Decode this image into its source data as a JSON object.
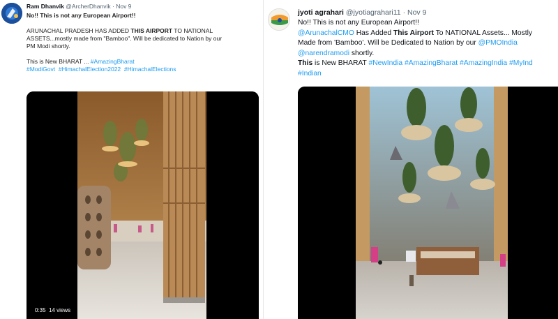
{
  "left_tweet": {
    "display_name": "Ram Dhanvik",
    "handle": "@ArcherDhanvik",
    "separator": "·",
    "date": "Nov 9",
    "line1": "No!! This is not any European Airport!!",
    "line2a": "ARUNACHAL PRADESH HAS ADDED ",
    "line2b": "THIS AIRPORT",
    "line2c": " TO NATIONAL",
    "line3": "ASSETS...mostly made from \"Bamboo\". Will be dedicated to Nation by our",
    "line4": "PM Modi shortly.",
    "line5a": "This is New BHARAT ... ",
    "tag_amazing": "#AmazingBharat",
    "tag_modigovt": "#ModiGovt",
    "tag_himachal2022": "#HimachalElection2022",
    "tag_himachal": "#HimachalElections",
    "video_time": "0:35",
    "video_views": "14 views"
  },
  "right_tweet": {
    "display_name": "jyoti agrahari",
    "handle": "@jyotiagrahari11",
    "separator": "·",
    "date": "Nov 9",
    "line1": "No!! This is not any European Airport!!",
    "mention_cmo": "@ArunachalCMO",
    "line2a": " Has Added ",
    "line2b": "This Airport",
    "line2c": " To NATIONAL Assets... Mostly",
    "line3a": "Made from 'Bamboo'. Will be Dedicated to Nation by our ",
    "mention_pmo": "@PMOIndia",
    "mention_modi": "@narendramodi",
    "line4": " shortly.",
    "line5a": "This",
    "line5b": " is New BHARAT ",
    "tag_newindia": "#NewIndia",
    "tag_amazingbharat": "#AmazingBharat",
    "tag_amazingindia": "#AmazingIndia",
    "tag_myind": "#MyInd",
    "tag_indian": "#Indian"
  }
}
